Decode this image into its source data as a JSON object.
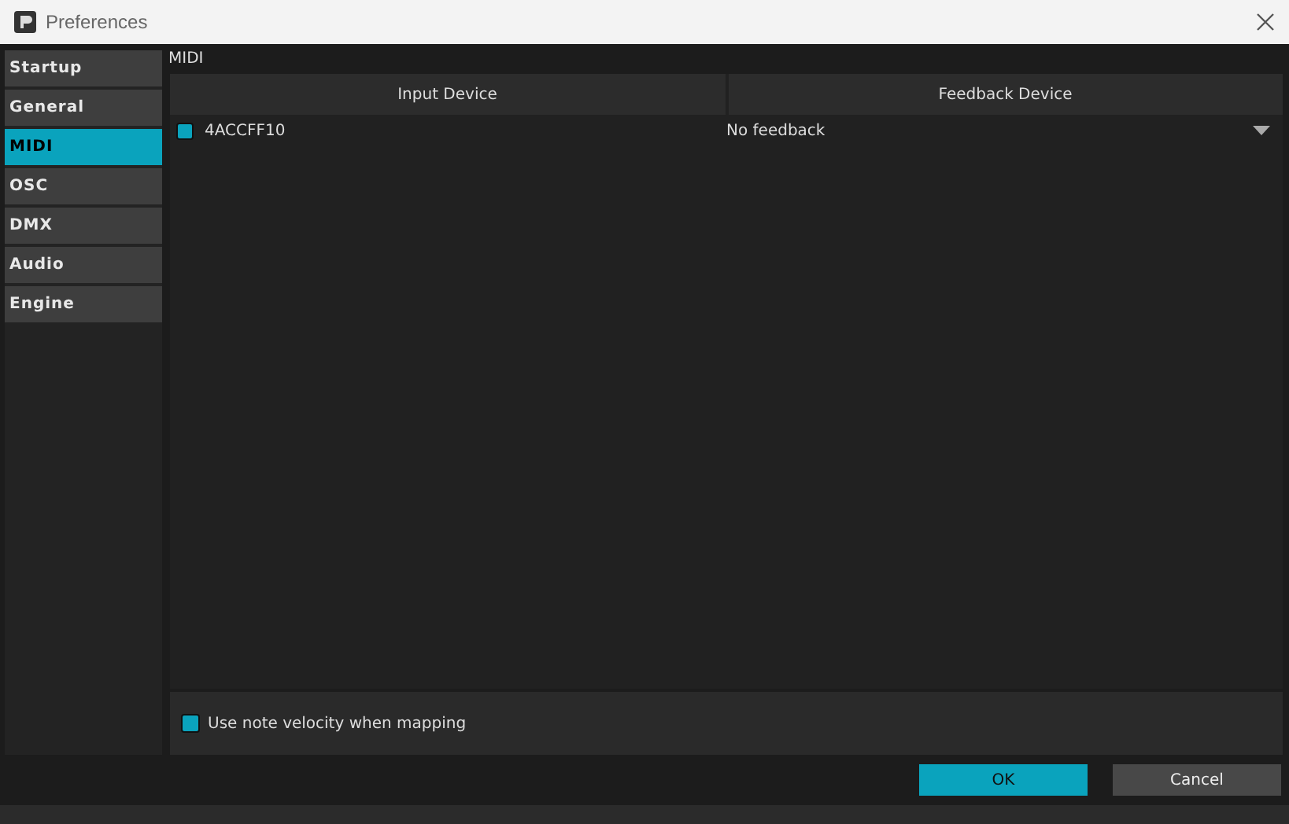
{
  "window": {
    "title": "Preferences"
  },
  "sidebar": {
    "items": [
      {
        "label": "Startup",
        "selected": false
      },
      {
        "label": "General",
        "selected": false
      },
      {
        "label": "MIDI",
        "selected": true
      },
      {
        "label": "OSC",
        "selected": false
      },
      {
        "label": "DMX",
        "selected": false
      },
      {
        "label": "Audio",
        "selected": false
      },
      {
        "label": "Engine",
        "selected": false
      }
    ]
  },
  "section_title": "MIDI",
  "table": {
    "columns": [
      "Input Device",
      "Feedback Device"
    ],
    "rows": [
      {
        "input": "4ACCFF10",
        "checked": true,
        "feedback": "No feedback"
      }
    ]
  },
  "options": [
    {
      "label": "Use note velocity when mapping",
      "checked": true
    }
  ],
  "buttons": [
    {
      "label": "OK",
      "kind": "primary"
    },
    {
      "label": "Cancel",
      "kind": "secondary"
    }
  ]
}
